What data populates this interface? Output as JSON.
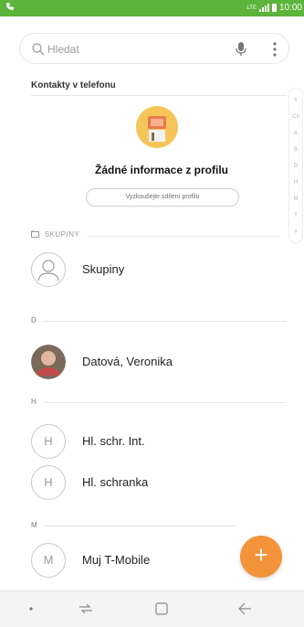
{
  "status_bar": {
    "network": "LTE",
    "time": "10:00"
  },
  "search": {
    "placeholder": "Hledat",
    "icons": [
      "search-icon",
      "microphone-icon",
      "more-vert-icon"
    ]
  },
  "section_title": "Kontakty v telefonu",
  "index_letters": [
    "#",
    "Ch",
    "A",
    "B",
    "D",
    "H",
    "M",
    "T",
    "#"
  ],
  "profile": {
    "title": "Žádné informace z profilu",
    "share_button": "Vyzkoušejte sdílení profilu"
  },
  "groups_header": "SKUPINY",
  "groups_row": {
    "name": "Skupiny"
  },
  "sections": [
    {
      "letter": "D",
      "contacts": [
        {
          "name": "Datová, Veronika",
          "initial": ""
        }
      ]
    },
    {
      "letter": "H",
      "contacts": [
        {
          "name": "Hl. schr. Int.",
          "initial": "H"
        },
        {
          "name": "Hl. schranka",
          "initial": "H"
        }
      ]
    },
    {
      "letter": "M",
      "contacts": [
        {
          "name": "Muj T-Mobile",
          "initial": "M"
        }
      ]
    }
  ],
  "fab_symbol": "+",
  "colors": {
    "status_bar": "#5cb43a",
    "fab": "#f3933a",
    "profile_avatar": "#f5c55a"
  }
}
